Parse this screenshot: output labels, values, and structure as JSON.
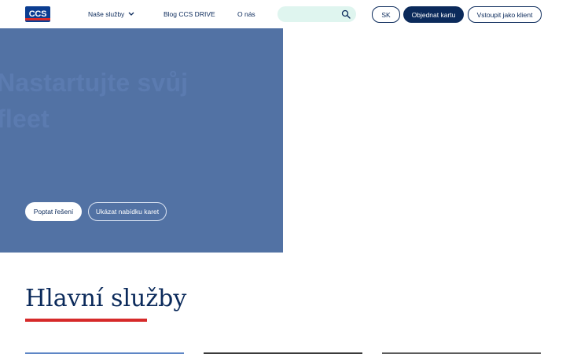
{
  "header": {
    "logo_text": "CCS",
    "nav": {
      "sluzby": "Naše služby",
      "blog": "Blog CCS DRIVE",
      "onas": "O nás"
    },
    "search": {
      "placeholder": ""
    },
    "buttons": {
      "sk": "SK",
      "order": "Objednat kartu",
      "login": "Vstoupit jako klient"
    }
  },
  "hero": {
    "title": "Nastartujte svůj fleet",
    "cta_primary": "Poptat řešení",
    "cta_secondary": "Ukázat nabídku karet",
    "colors": {
      "background": "#5272a4"
    }
  },
  "section": {
    "title": "Hlavní služby",
    "accent": "#d62a2a"
  },
  "colors": {
    "brand_navy": "#0b2a5b",
    "search_bg": "#dff5ef"
  }
}
